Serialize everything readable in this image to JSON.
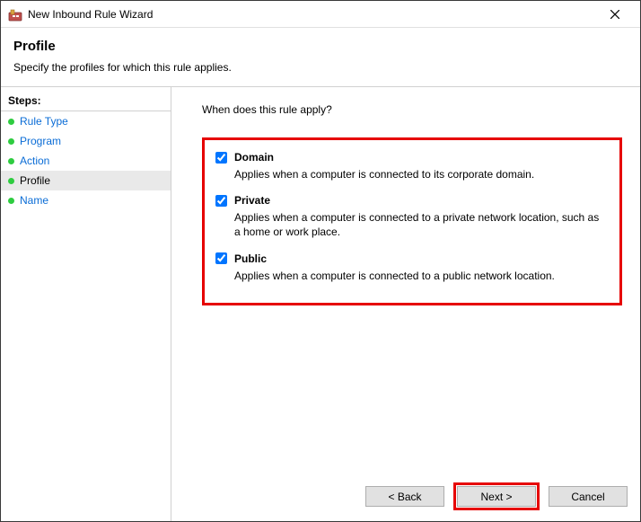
{
  "titlebar": {
    "title": "New Inbound Rule Wizard"
  },
  "header": {
    "page_title": "Profile",
    "subtitle": "Specify the profiles for which this rule applies."
  },
  "sidebar": {
    "heading": "Steps:",
    "items": [
      {
        "label": "Rule Type",
        "current": false
      },
      {
        "label": "Program",
        "current": false
      },
      {
        "label": "Action",
        "current": false
      },
      {
        "label": "Profile",
        "current": true
      },
      {
        "label": "Name",
        "current": false
      }
    ]
  },
  "content": {
    "question": "When does this rule apply?",
    "options": [
      {
        "label": "Domain",
        "checked": true,
        "description": "Applies when a computer is connected to its corporate domain."
      },
      {
        "label": "Private",
        "checked": true,
        "description": "Applies when a computer is connected to a private network location, such as a home or work place."
      },
      {
        "label": "Public",
        "checked": true,
        "description": "Applies when a computer is connected to a public network location."
      }
    ]
  },
  "footer": {
    "back": "< Back",
    "next": "Next >",
    "cancel": "Cancel"
  }
}
